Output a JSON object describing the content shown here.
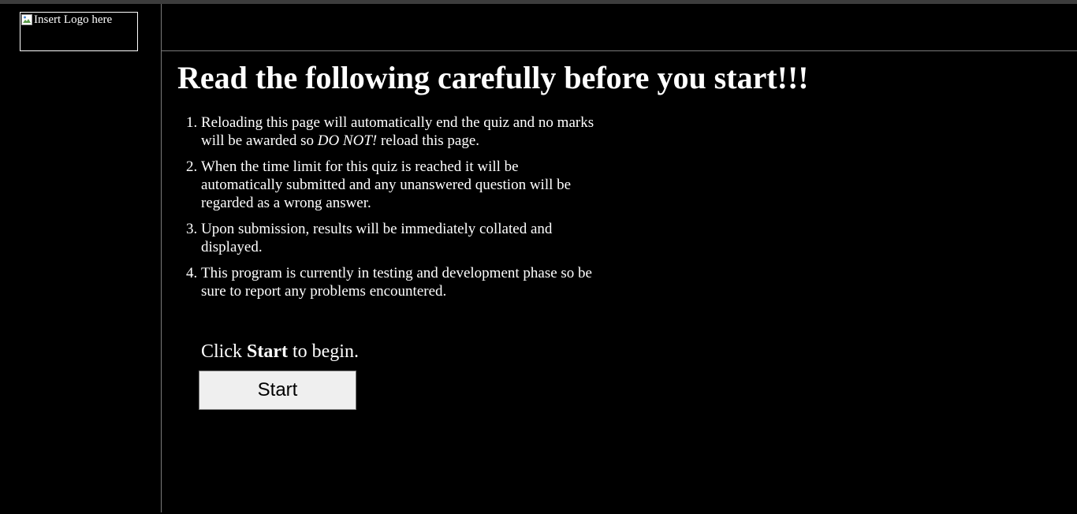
{
  "sidebar": {
    "logo_alt": "Insert Logo here"
  },
  "main": {
    "title": "Read the following carefully before you start!!!",
    "rules": [
      {
        "before": "Reloading this page will automatically end the quiz and no marks will be awarded so ",
        "emphasis": "DO NOT!",
        "after": " reload this page."
      },
      {
        "text": "When the time limit for this quiz is reached it will be automatically submitted and any unanswered question will be regarded as a wrong answer."
      },
      {
        "text": "Upon submission, results will be immediately collated and displayed."
      },
      {
        "text": "This program is currently in testing and development phase so be sure to report any problems encountered."
      }
    ],
    "cta": {
      "prefix": "Click ",
      "strong": "Start",
      "suffix": " to begin."
    },
    "start_button_label": "Start"
  },
  "colors": {
    "background": "#000000",
    "text": "#ffffff",
    "divider": "#7a7a7a",
    "button_bg": "#efefef"
  }
}
